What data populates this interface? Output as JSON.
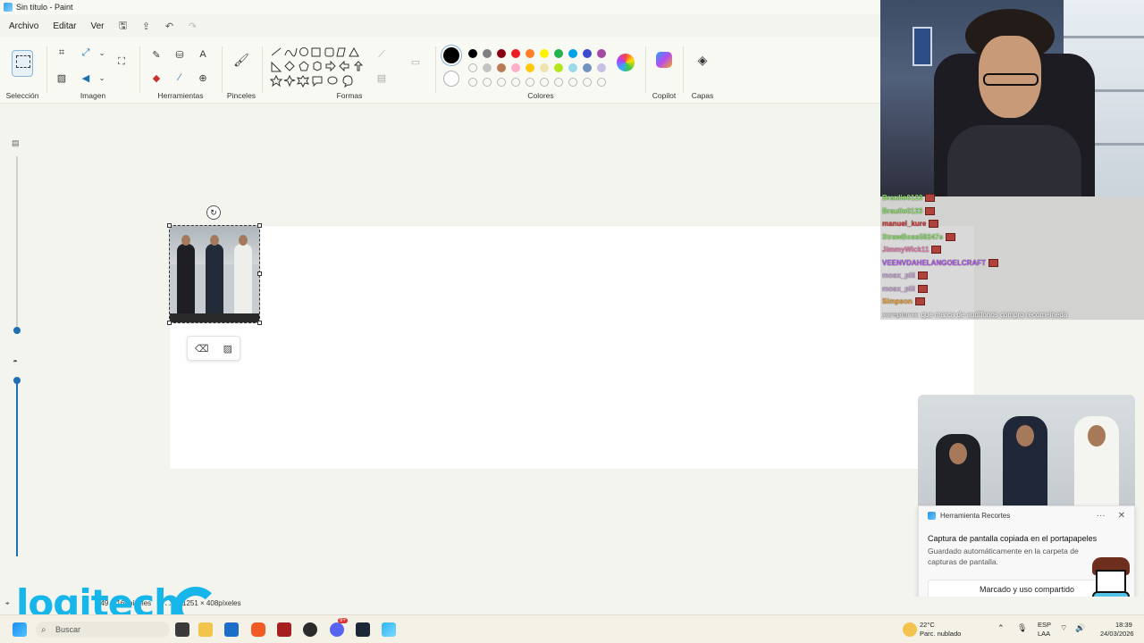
{
  "window": {
    "title": "Sin título - Paint"
  },
  "menu": {
    "file": "Archivo",
    "edit": "Editar",
    "view": "Ver"
  },
  "ribbon": {
    "groups": {
      "selection": "Selección",
      "image": "Imagen",
      "tools": "Herramientas",
      "brushes": "Pinceles",
      "shapes": "Formas",
      "colors": "Colores",
      "copilot": "Copilot",
      "layers": "Capas"
    },
    "palette_row1": [
      "#000000",
      "#7f7f7f",
      "#880015",
      "#ed1c24",
      "#ff7f27",
      "#fff200",
      "#22b14c",
      "#00a2e8",
      "#3f48cc",
      "#a349a4"
    ],
    "palette_row2": [
      "",
      "#c3c3c3",
      "#b97a57",
      "#ffaec9",
      "#ffc90e",
      "#efe4b0",
      "#b5e61d",
      "#99d9ea",
      "#7092be",
      "#c8bfe7"
    ],
    "primary_color": "#000000",
    "secondary_color": "#ffffff"
  },
  "chat": [
    {
      "name": "Braulio0123",
      "msg": "",
      "color": "#8ee36b"
    },
    {
      "name": "Braulio0123",
      "msg": "",
      "color": "#8ee36b"
    },
    {
      "name": "manuel_kure",
      "msg": "",
      "color": "#d83a3a"
    },
    {
      "name": "StrawBoss59247e",
      "msg": "",
      "color": "#8ee36b"
    },
    {
      "name": "JimmyWick11",
      "msg": "",
      "color": "#ea7fb3"
    },
    {
      "name": "VEENVDAHELANGOELCRAFT",
      "msg": "",
      "color": "#b45cf0"
    },
    {
      "name": "mosx_plii",
      "msg": "",
      "color": "#c8a6d8"
    },
    {
      "name": "mosx_plii",
      "msg": "",
      "color": "#c8a6d8"
    },
    {
      "name": "Simpson",
      "msg": "",
      "color": "#f0a030"
    },
    {
      "name": "xxreptarxx",
      "msg": "que marca de audífonos compro recomeineda",
      "color": "#dddddd"
    }
  ],
  "toast": {
    "app": "Herramienta Recortes",
    "more": "···",
    "close": "✕",
    "title": "Captura de pantalla copiada en el portapapeles",
    "body": "Guardado automáticamente en la carpeta de capturas de pantalla.",
    "action": "Marcado y uso compartido"
  },
  "status": {
    "selection_size": "149 × 163píxeles",
    "canvas_size": "1251 × 408píxeles"
  },
  "overlay": {
    "brand": "logitech"
  },
  "taskbar": {
    "search_placeholder": "Buscar",
    "weather_temp": "22°C",
    "weather_desc": "Parc. nublado",
    "lang_line1": "ESP",
    "lang_line2": "LAA",
    "time": "18:39",
    "date": "24/03/2026",
    "discord_badge": "9+"
  }
}
